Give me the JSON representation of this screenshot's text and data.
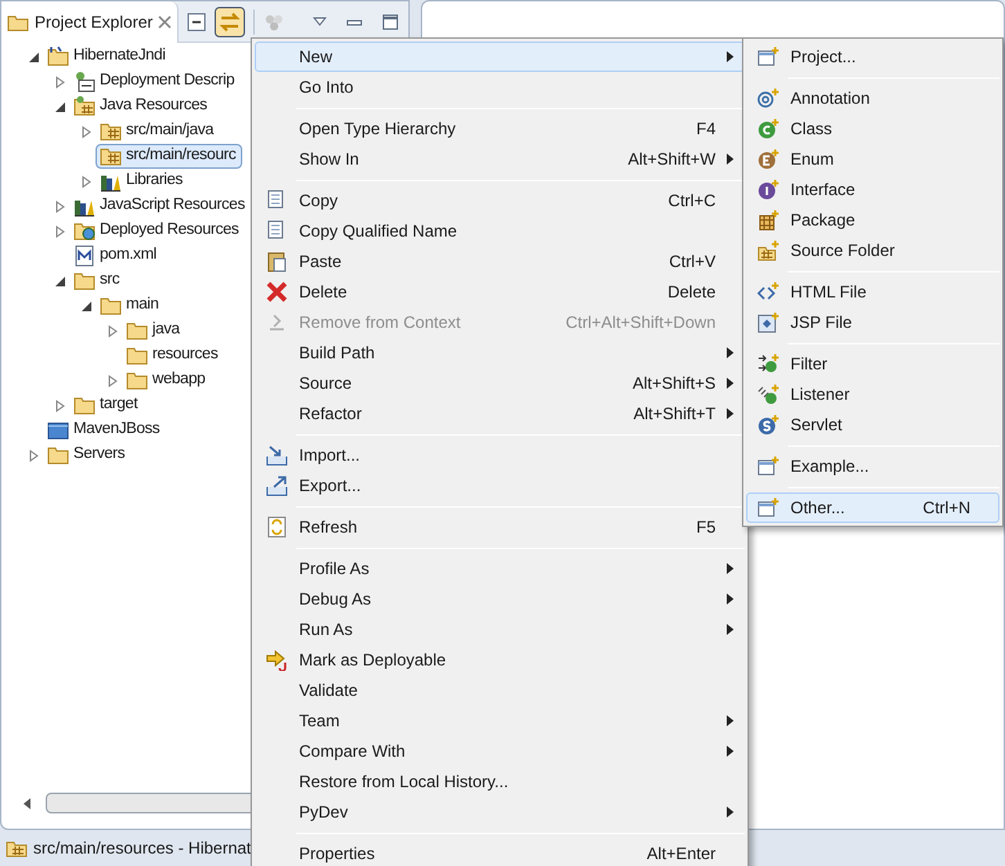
{
  "view": {
    "title": "Project Explorer",
    "tree": [
      {
        "label": "HibernateJndi",
        "kind": "project",
        "expanded": true,
        "selected": false,
        "children": [
          {
            "label": "Deployment Descrip",
            "kind": "descriptor",
            "expanded": false,
            "selected": false
          },
          {
            "label": "Java Resources",
            "kind": "resources",
            "expanded": true,
            "selected": false,
            "children": [
              {
                "label": "src/main/java",
                "kind": "package",
                "expanded": false,
                "selected": false
              },
              {
                "label": "src/main/resourc",
                "kind": "package",
                "selected": true
              },
              {
                "label": "Libraries",
                "kind": "library",
                "expanded": false,
                "selected": false
              }
            ]
          },
          {
            "label": "JavaScript Resources",
            "kind": "library",
            "expanded": false,
            "selected": false
          },
          {
            "label": "Deployed Resources",
            "kind": "deployed",
            "expanded": false,
            "selected": false
          },
          {
            "label": "pom.xml",
            "kind": "maven",
            "selected": false
          },
          {
            "label": "src",
            "kind": "folder",
            "expanded": true,
            "selected": false,
            "children": [
              {
                "label": "main",
                "kind": "folder",
                "expanded": true,
                "selected": false,
                "children": [
                  {
                    "label": "java",
                    "kind": "folder",
                    "expanded": false,
                    "selected": false
                  },
                  {
                    "label": "resources",
                    "kind": "folder",
                    "selected": false
                  },
                  {
                    "label": "webapp",
                    "kind": "folder",
                    "expanded": false,
                    "selected": false
                  }
                ]
              }
            ]
          },
          {
            "label": "target",
            "kind": "folder",
            "expanded": false,
            "selected": false
          }
        ]
      },
      {
        "label": "MavenJBoss",
        "kind": "closed",
        "selected": false
      },
      {
        "label": "Servers",
        "kind": "folder",
        "expanded": false,
        "selected": false
      }
    ]
  },
  "status_bar": {
    "text": "src/main/resources - Hibernat"
  },
  "context_menu": {
    "items": [
      {
        "kind": "plain",
        "label": "New",
        "submenu": true,
        "selected": true
      },
      {
        "kind": "plain",
        "label": "Go Into",
        "selected": false
      },
      {
        "kind": "separator"
      },
      {
        "kind": "plain",
        "label": "Open Type Hierarchy",
        "shortcut": "F4",
        "selected": false
      },
      {
        "kind": "plain",
        "label": "Show In",
        "shortcut": "Alt+Shift+W",
        "submenu": true,
        "selected": false
      },
      {
        "kind": "separator"
      },
      {
        "kind": "copy",
        "label": "Copy",
        "shortcut": "Ctrl+C",
        "selected": false
      },
      {
        "kind": "copy",
        "label": "Copy Qualified Name",
        "selected": false
      },
      {
        "kind": "paste",
        "label": "Paste",
        "shortcut": "Ctrl+V",
        "selected": false
      },
      {
        "kind": "delete",
        "label": "Delete",
        "shortcut": "Delete",
        "selected": false
      },
      {
        "kind": "remove",
        "label": "Remove from Context",
        "shortcut": "Ctrl+Alt+Shift+Down",
        "disabled": true,
        "selected": false
      },
      {
        "kind": "plain",
        "label": "Build Path",
        "submenu": true,
        "selected": false
      },
      {
        "kind": "plain",
        "label": "Source",
        "shortcut": "Alt+Shift+S",
        "submenu": true,
        "selected": false
      },
      {
        "kind": "plain",
        "label": "Refactor",
        "shortcut": "Alt+Shift+T",
        "submenu": true,
        "selected": false
      },
      {
        "kind": "separator"
      },
      {
        "kind": "import",
        "label": "Import...",
        "selected": false
      },
      {
        "kind": "export",
        "label": "Export...",
        "selected": false
      },
      {
        "kind": "separator"
      },
      {
        "kind": "refresh",
        "label": "Refresh",
        "shortcut": "F5",
        "selected": false
      },
      {
        "kind": "separator"
      },
      {
        "kind": "plain",
        "label": "Profile As",
        "submenu": true,
        "selected": false
      },
      {
        "kind": "plain",
        "label": "Debug As",
        "submenu": true,
        "selected": false
      },
      {
        "kind": "plain",
        "label": "Run As",
        "submenu": true,
        "selected": false
      },
      {
        "kind": "deploy",
        "label": "Mark as Deployable",
        "selected": false
      },
      {
        "kind": "plain",
        "label": "Validate",
        "selected": false
      },
      {
        "kind": "plain",
        "label": "Team",
        "submenu": true,
        "selected": false
      },
      {
        "kind": "plain",
        "label": "Compare With",
        "submenu": true,
        "selected": false
      },
      {
        "kind": "plain",
        "label": "Restore from Local History...",
        "selected": false
      },
      {
        "kind": "plain",
        "label": "PyDev",
        "submenu": true,
        "selected": false
      },
      {
        "kind": "separator"
      },
      {
        "kind": "plain",
        "label": "Properties",
        "shortcut": "Alt+Enter",
        "selected": false
      }
    ]
  },
  "new_submenu": {
    "items": [
      {
        "kind": "wizard",
        "label": "Project...",
        "selected": false
      },
      {
        "kind": "separator"
      },
      {
        "kind": "annotation",
        "label": "Annotation",
        "selected": false
      },
      {
        "kind": "class",
        "label": "Class",
        "selected": false
      },
      {
        "kind": "enum",
        "label": "Enum",
        "selected": false
      },
      {
        "kind": "interface",
        "label": "Interface",
        "selected": false
      },
      {
        "kind": "package",
        "label": "Package",
        "selected": false
      },
      {
        "kind": "sourcefolder",
        "label": "Source Folder",
        "selected": false
      },
      {
        "kind": "separator"
      },
      {
        "kind": "html",
        "label": "HTML File",
        "selected": false
      },
      {
        "kind": "jsp",
        "label": "JSP File",
        "selected": false
      },
      {
        "kind": "separator"
      },
      {
        "kind": "filter",
        "label": "Filter",
        "selected": false
      },
      {
        "kind": "listener",
        "label": "Listener",
        "selected": false
      },
      {
        "kind": "servlet",
        "label": "Servlet",
        "selected": false
      },
      {
        "kind": "separator"
      },
      {
        "kind": "wizard",
        "label": "Example...",
        "selected": false
      },
      {
        "kind": "separator"
      },
      {
        "kind": "wizard",
        "label": "Other...",
        "shortcut": "Ctrl+N",
        "selected": true
      }
    ]
  }
}
